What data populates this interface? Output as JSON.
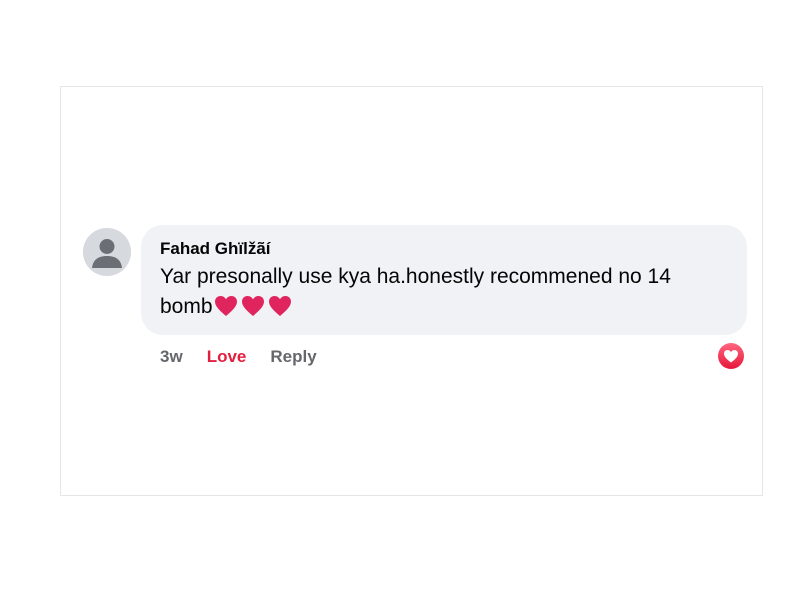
{
  "comment": {
    "author": "Fahad Ghïlžãí",
    "text": "Yar presonally use kya ha.honestly recommened no 14 bomb",
    "emojis": [
      "red-heart",
      "red-heart",
      "red-heart"
    ],
    "timestamp": "3w",
    "love_label": "Love",
    "reply_label": "Reply",
    "reaction": "love"
  },
  "colors": {
    "bubble": "#f0f2f5",
    "love": "#e41e3f",
    "muted": "#65676b",
    "heart": "#e0245e"
  }
}
